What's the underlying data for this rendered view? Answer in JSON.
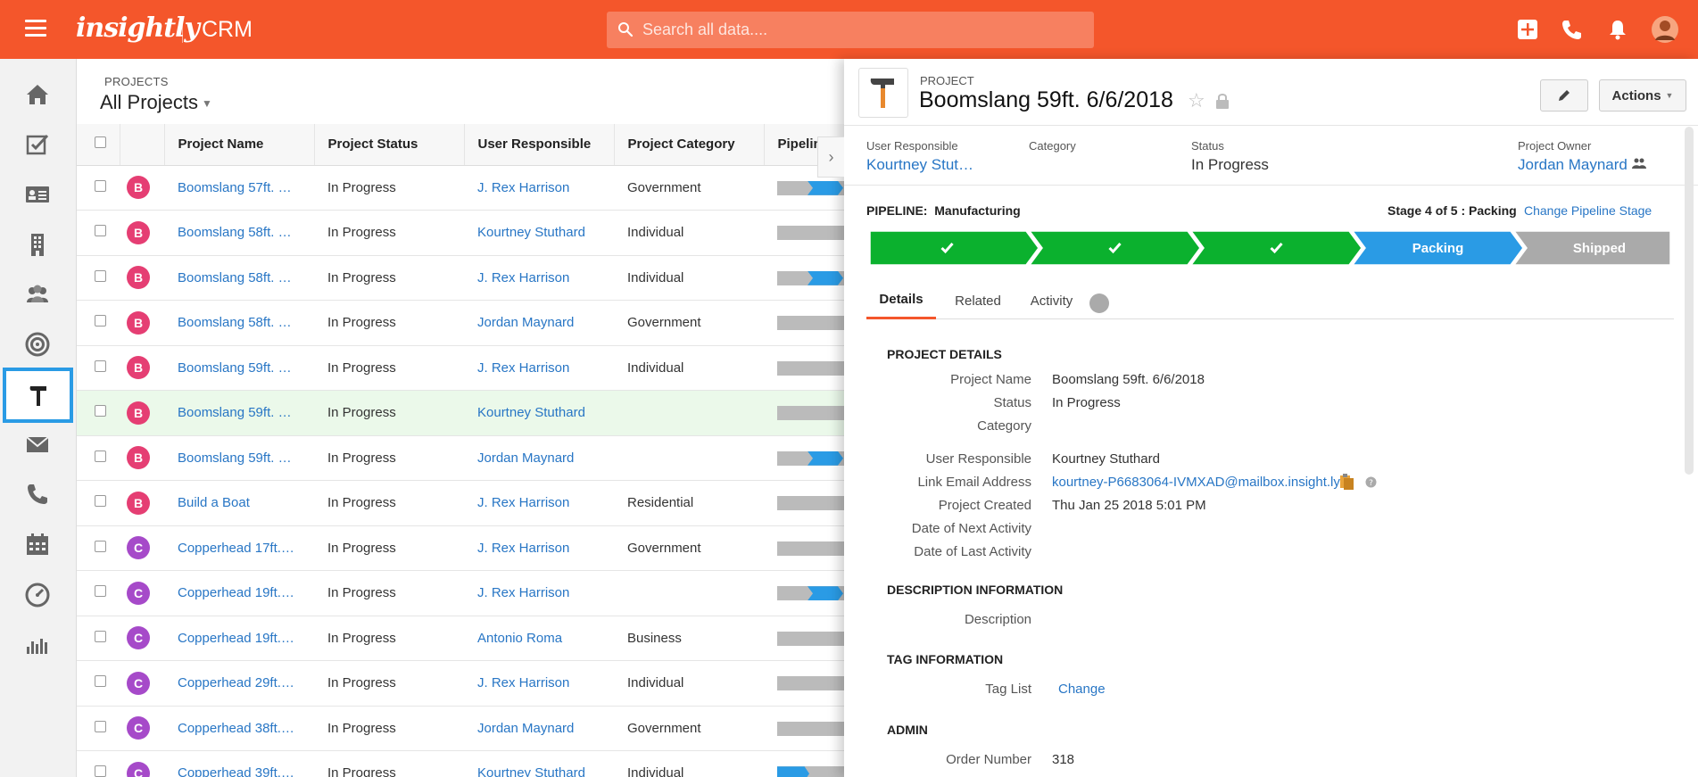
{
  "topbar": {
    "brand": "insightly",
    "app_title": "CRM",
    "search_placeholder": "Search all data...."
  },
  "colors": {
    "accent": "#f4562b",
    "link": "#2876c5",
    "pipeline_done": "#0bb12e",
    "pipeline_current": "#2a9be5",
    "pipeline_future": "#aaaaaa",
    "avatar_b": "#e53e73",
    "avatar_c": "#a64ac9"
  },
  "nav": {
    "items": [
      "home-icon",
      "tasks-icon",
      "contacts-icon",
      "organizations-icon",
      "partners-icon",
      "opportunities-icon",
      "projects-icon",
      "email-icon",
      "calls-icon",
      "calendar-icon",
      "dashboard-icon",
      "reports-icon"
    ],
    "active": "projects-icon"
  },
  "projects": {
    "label": "PROJECTS",
    "view": "All Projects",
    "columns": [
      "Project Name",
      "Project Status",
      "User Responsible",
      "Project Category",
      "Pipeline"
    ],
    "rows": [
      {
        "initial": "B",
        "name": "Boomslang 57ft. …",
        "status": "In Progress",
        "user": "J. Rex Harrison",
        "category": "Government",
        "pipe": 1
      },
      {
        "initial": "B",
        "name": "Boomslang 58ft. …",
        "status": "In Progress",
        "user": "Kourtney Stuthard",
        "category": "Individual",
        "pipe": 0
      },
      {
        "initial": "B",
        "name": "Boomslang 58ft. …",
        "status": "In Progress",
        "user": "J. Rex Harrison",
        "category": "Individual",
        "pipe": 1
      },
      {
        "initial": "B",
        "name": "Boomslang 58ft. …",
        "status": "In Progress",
        "user": "Jordan Maynard",
        "category": "Government",
        "pipe": 0
      },
      {
        "initial": "B",
        "name": "Boomslang 59ft. …",
        "status": "In Progress",
        "user": "J. Rex Harrison",
        "category": "Individual",
        "pipe": 0
      },
      {
        "initial": "B",
        "name": "Boomslang 59ft. …",
        "status": "In Progress",
        "user": "Kourtney Stuthard",
        "category": "",
        "pipe": 0,
        "selected": true
      },
      {
        "initial": "B",
        "name": "Boomslang 59ft. …",
        "status": "In Progress",
        "user": "Jordan Maynard",
        "category": "",
        "pipe": 1
      },
      {
        "initial": "B",
        "name": "Build a Boat",
        "status": "In Progress",
        "user": "J. Rex Harrison",
        "category": "Residential",
        "pipe": 0
      },
      {
        "initial": "C",
        "name": "Copperhead 17ft.…",
        "status": "In Progress",
        "user": "J. Rex Harrison",
        "category": "Government",
        "pipe": 0
      },
      {
        "initial": "C",
        "name": "Copperhead 19ft.…",
        "status": "In Progress",
        "user": "J. Rex Harrison",
        "category": "",
        "pipe": 1
      },
      {
        "initial": "C",
        "name": "Copperhead 19ft.…",
        "status": "In Progress",
        "user": "Antonio Roma",
        "category": "Business",
        "pipe": 0
      },
      {
        "initial": "C",
        "name": "Copperhead 29ft.…",
        "status": "In Progress",
        "user": "J. Rex Harrison",
        "category": "Individual",
        "pipe": 0
      },
      {
        "initial": "C",
        "name": "Copperhead 38ft.…",
        "status": "In Progress",
        "user": "Jordan Maynard",
        "category": "Government",
        "pipe": 0
      },
      {
        "initial": "C",
        "name": "Copperhead 39ft.…",
        "status": "In Progress",
        "user": "Kourtney Stuthard",
        "category": "Individual",
        "pipe": 2
      }
    ]
  },
  "detail": {
    "type_label": "PROJECT",
    "title": "Boomslang 59ft. 6/6/2018",
    "actions_label": "Actions",
    "summary": {
      "user_label": "User Responsible",
      "user_value": "Kourtney Stut…",
      "category_label": "Category",
      "category_value": "",
      "status_label": "Status",
      "status_value": "In Progress",
      "owner_label": "Project Owner",
      "owner_value": "Jordan Maynard"
    },
    "pipeline": {
      "label": "PIPELINE:",
      "name": "Manufacturing",
      "stage_text": "Stage 4 of 5 : Packing",
      "change_label": "Change Pipeline Stage",
      "stages": [
        {
          "label": "",
          "state": "done"
        },
        {
          "label": "",
          "state": "done"
        },
        {
          "label": "",
          "state": "done"
        },
        {
          "label": "Packing",
          "state": "current"
        },
        {
          "label": "Shipped",
          "state": "future"
        }
      ]
    },
    "tabs": [
      "Details",
      "Related",
      "Activity"
    ],
    "active_tab": "Details",
    "sections": {
      "project_details": "PROJECT DETAILS",
      "description_info": "DESCRIPTION INFORMATION",
      "tag_info": "TAG INFORMATION",
      "admin": "ADMIN"
    },
    "fields": {
      "project_name_label": "Project Name",
      "project_name": "Boomslang 59ft. 6/6/2018",
      "status_label": "Status",
      "status": "In Progress",
      "category_label": "Category",
      "category": "",
      "user_label": "User Responsible",
      "user": "Kourtney Stuthard",
      "email_label": "Link Email Address",
      "email": "kourtney-P6683064-IVMXAD@mailbox.insight.ly",
      "created_label": "Project Created",
      "created": "Thu Jan 25 2018 5:01 PM",
      "next_activity_label": "Date of Next Activity",
      "next_activity": "",
      "last_activity_label": "Date of Last Activity",
      "last_activity": "",
      "description_label": "Description",
      "description": "",
      "tag_list_label": "Tag List",
      "tag_change": "Change",
      "order_label": "Order Number",
      "order": "318"
    }
  }
}
